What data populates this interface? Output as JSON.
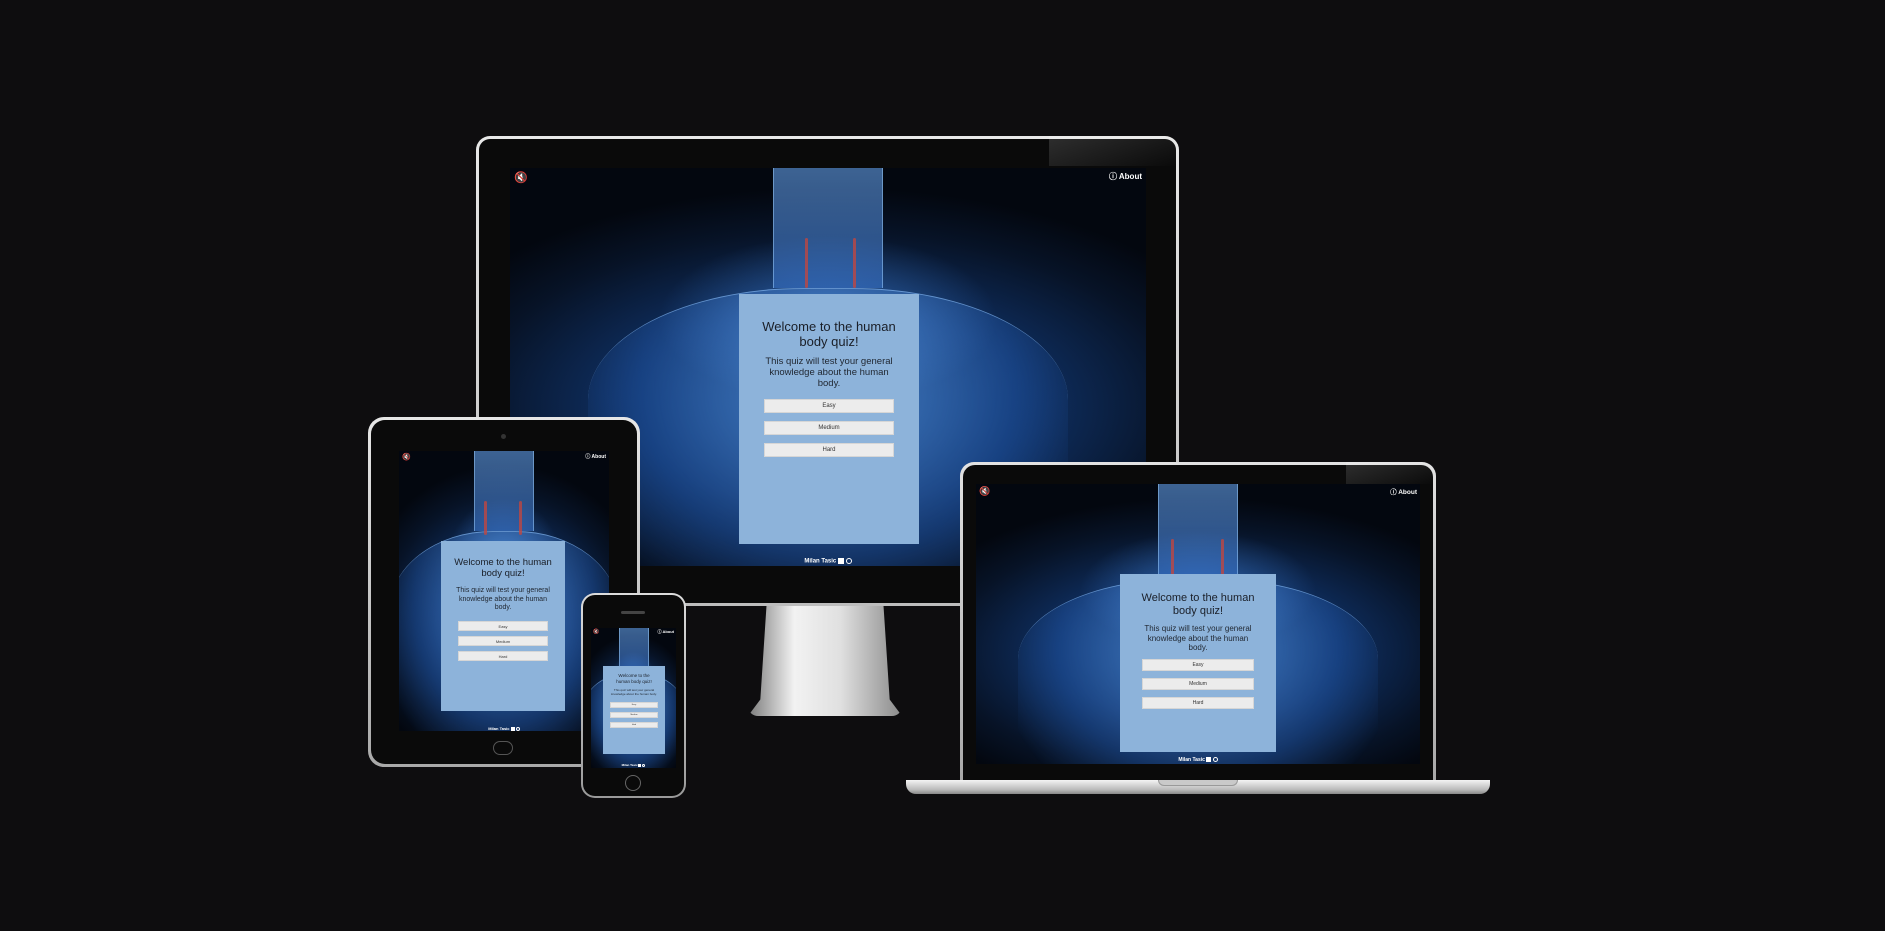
{
  "quiz": {
    "title": "Welcome to the human body quiz!",
    "description": "This quiz will test your general knowledge about the human body.",
    "buttons": [
      "Easy",
      "Medium",
      "Hard"
    ]
  },
  "header": {
    "mute_icon": "mute-speaker-icon",
    "about_label": "About",
    "about_icon": "info-icon"
  },
  "footer": {
    "author": "Milan Tasic",
    "icons": [
      "linkedin-icon",
      "github-icon"
    ]
  },
  "colors": {
    "page_background": "#0e0d0f",
    "card": "#8db3da",
    "button": "#ececec"
  }
}
